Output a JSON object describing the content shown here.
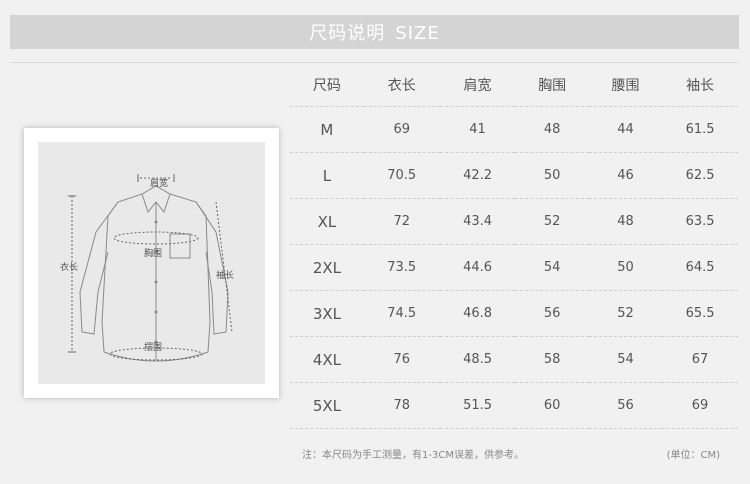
{
  "header": {
    "title_cn": "尺码说明",
    "title_en": "SIZE"
  },
  "diagram": {
    "labels": {
      "shoulder": "肩宽",
      "chest": "胸围",
      "length": "衣长",
      "sleeve": "袖长",
      "hem": "摆围"
    }
  },
  "table": {
    "headers": [
      "尺码",
      "衣长",
      "肩宽",
      "胸围",
      "腰围",
      "袖长"
    ],
    "rows": [
      [
        "M",
        "69",
        "41",
        "48",
        "44",
        "61.5"
      ],
      [
        "L",
        "70.5",
        "42.2",
        "50",
        "46",
        "62.5"
      ],
      [
        "XL",
        "72",
        "43.4",
        "52",
        "48",
        "63.5"
      ],
      [
        "2XL",
        "73.5",
        "44.6",
        "54",
        "50",
        "64.5"
      ],
      [
        "3XL",
        "74.5",
        "46.8",
        "56",
        "52",
        "65.5"
      ],
      [
        "4XL",
        "76",
        "48.5",
        "58",
        "54",
        "67"
      ],
      [
        "5XL",
        "78",
        "51.5",
        "60",
        "56",
        "69"
      ]
    ]
  },
  "footer": {
    "note": "注：本尺码为手工测量，有1-3CM误差，供参考。",
    "unit": "(单位：CM)"
  }
}
